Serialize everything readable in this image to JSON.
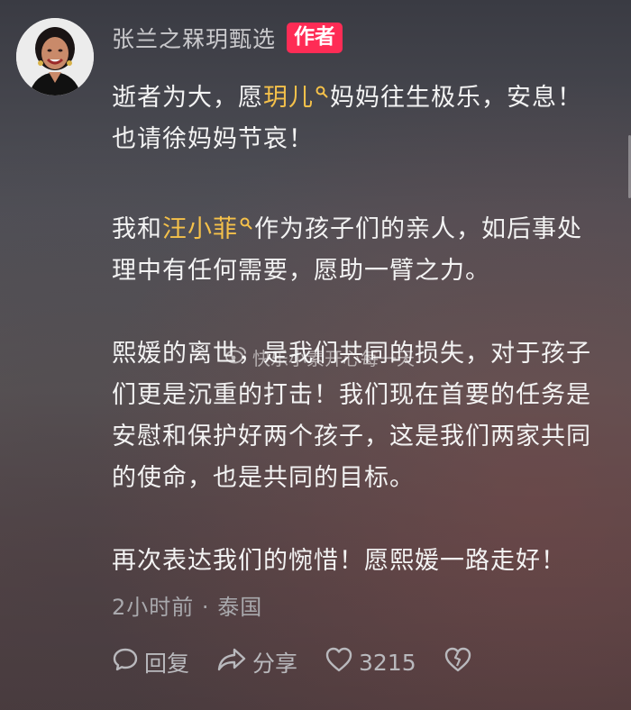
{
  "comment": {
    "username": "张兰之槑玥甄选",
    "author_badge": "作者",
    "paragraphs": [
      {
        "line1_a": "逝者为大，愿",
        "mention": "玥儿",
        "line1_b": "妈妈往生极乐，安息！",
        "line2": "也请徐妈妈节哀！"
      },
      {
        "line1_a": "我和",
        "mention": "汪小菲",
        "line1_b": "作为孩子们的亲人，如后事处",
        "line2": "理中有任何需要，愿助一臂之力。"
      },
      {
        "lines": [
          "熙媛的离世，是我们共同的损失，对于孩子",
          "们更是沉重的打击！我们现在首要的任务是",
          "安慰和保护好两个孩子，这是我们两家共同",
          "的使命，也是共同的目标。"
        ]
      },
      {
        "lines": [
          "再次表达我们的惋惜！愿熙媛一路走好！"
        ]
      }
    ],
    "time": "2小时前",
    "separator": "·",
    "location": "泰国",
    "actions": {
      "reply_label": "回复",
      "share_label": "分享",
      "like_count": "3215"
    }
  },
  "watermark": {
    "text": "快乐小素开心每一天"
  },
  "colors": {
    "mention": "#f5c14a",
    "author_badge": "#fe2c55",
    "username": "#c9c9cc",
    "meta": "#a9a9ad"
  },
  "icons": [
    "avatar",
    "search-icon",
    "comment-icon",
    "share-icon",
    "heart-icon",
    "broken-heart-icon",
    "weibo-icon"
  ]
}
